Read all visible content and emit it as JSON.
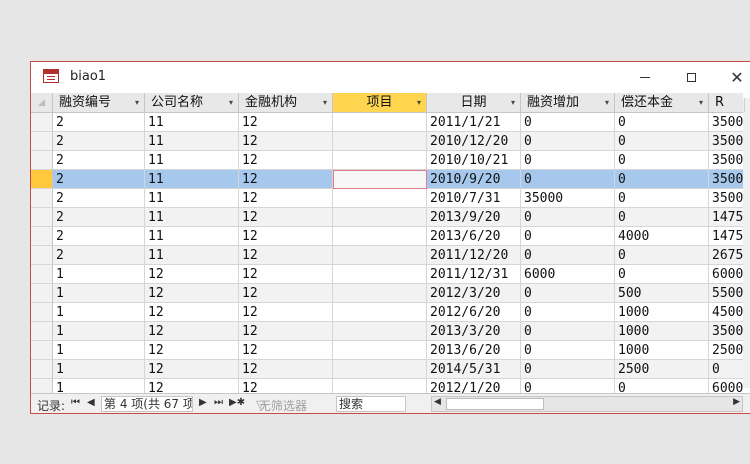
{
  "window": {
    "title": "biao1"
  },
  "columns": [
    {
      "label": "融资编号",
      "dropdown": "▾",
      "selected": false
    },
    {
      "label": "公司名称",
      "dropdown": "▾",
      "selected": false
    },
    {
      "label": "金融机构",
      "dropdown": "▾",
      "selected": false
    },
    {
      "label": "项目",
      "dropdown": "▾",
      "selected": true
    },
    {
      "label": "日期",
      "dropdown": "▾",
      "selected": false
    },
    {
      "label": "融资增加",
      "dropdown": "▾",
      "selected": false
    },
    {
      "label": "偿还本金",
      "dropdown": "▾",
      "selected": false
    },
    {
      "label": "R",
      "dropdown": "▾",
      "selected": false
    }
  ],
  "rows": [
    [
      "2",
      "11",
      "12",
      "",
      "2011/1/21",
      "0",
      "0",
      "3500"
    ],
    [
      "2",
      "11",
      "12",
      "",
      "2010/12/20",
      "0",
      "0",
      "3500"
    ],
    [
      "2",
      "11",
      "12",
      "",
      "2010/10/21",
      "0",
      "0",
      "3500"
    ],
    [
      "2",
      "11",
      "12",
      "",
      "2010/9/20",
      "0",
      "0",
      "3500"
    ],
    [
      "2",
      "11",
      "12",
      "",
      "2010/7/31",
      "35000",
      "0",
      "3500"
    ],
    [
      "2",
      "11",
      "12",
      "",
      "2013/9/20",
      "0",
      "0",
      "1475"
    ],
    [
      "2",
      "11",
      "12",
      "",
      "2013/6/20",
      "0",
      "4000",
      "1475"
    ],
    [
      "2",
      "11",
      "12",
      "",
      "2011/12/20",
      "0",
      "0",
      "2675"
    ],
    [
      "1",
      "12",
      "12",
      "",
      "2011/12/31",
      "6000",
      "0",
      "6000"
    ],
    [
      "1",
      "12",
      "12",
      "",
      "2012/3/20",
      "0",
      "500",
      "5500"
    ],
    [
      "1",
      "12",
      "12",
      "",
      "2012/6/20",
      "0",
      "1000",
      "4500"
    ],
    [
      "1",
      "12",
      "12",
      "",
      "2013/3/20",
      "0",
      "1000",
      "3500"
    ],
    [
      "1",
      "12",
      "12",
      "",
      "2013/6/20",
      "0",
      "1000",
      "2500"
    ],
    [
      "1",
      "12",
      "12",
      "",
      "2014/5/31",
      "0",
      "2500",
      "0"
    ],
    [
      "1",
      "12",
      "12",
      "",
      "2012/1/20",
      "0",
      "0",
      "6000"
    ]
  ],
  "current_row": 3,
  "navigation": {
    "label": "记录:",
    "position": "第 4 项(共 67 项",
    "no_filter": "无筛选器",
    "search": "搜索",
    "first": "⏮",
    "prev": "◀",
    "next": "▶",
    "last": "⏭",
    "new": "▶✱"
  },
  "colors": {
    "accent": "#c84b4b",
    "selected_header": "#ffd54f",
    "selected_row": "#a6c8ec"
  }
}
